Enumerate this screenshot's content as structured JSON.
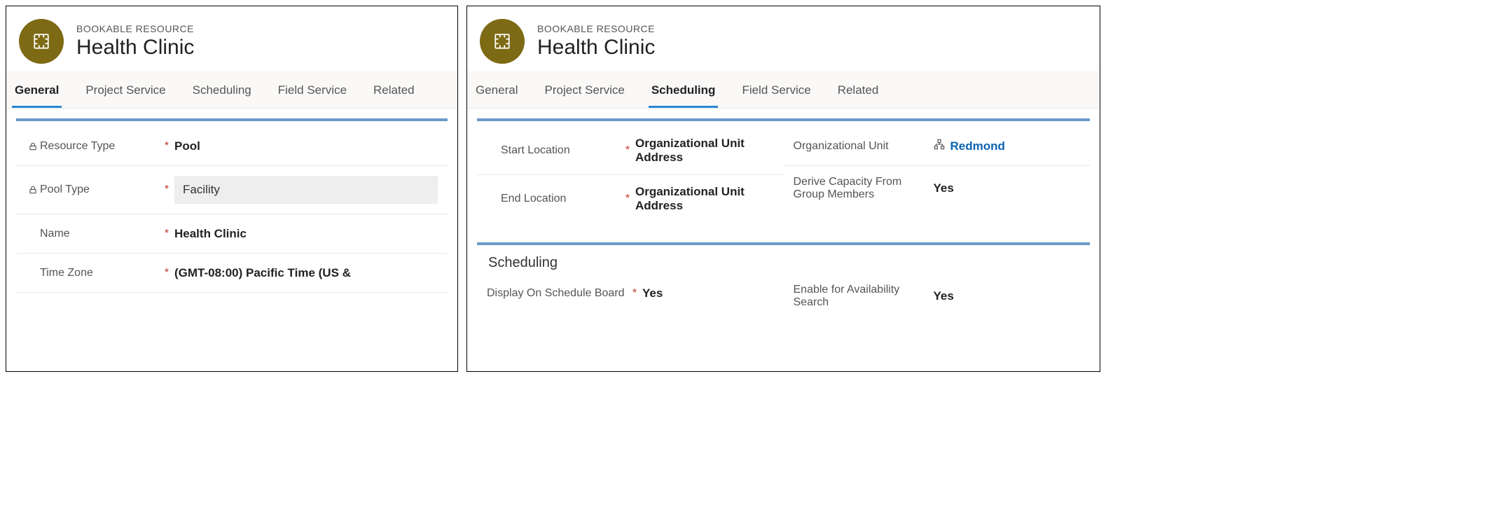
{
  "left": {
    "header": {
      "overline": "BOOKABLE RESOURCE",
      "title": "Health Clinic"
    },
    "tabs": [
      "General",
      "Project Service",
      "Scheduling",
      "Field Service",
      "Related"
    ],
    "active_tab": "General",
    "fields": {
      "resource_type": {
        "label": "Resource Type",
        "value": "Pool",
        "locked": true,
        "required": true
      },
      "pool_type": {
        "label": "Pool Type",
        "value": "Facility",
        "locked": true,
        "required": true
      },
      "name": {
        "label": "Name",
        "value": "Health Clinic",
        "locked": false,
        "required": true
      },
      "time_zone": {
        "label": "Time Zone",
        "value": "(GMT-08:00) Pacific Time (US &",
        "locked": false,
        "required": true
      }
    }
  },
  "right": {
    "header": {
      "overline": "BOOKABLE RESOURCE",
      "title": "Health Clinic"
    },
    "tabs": [
      "General",
      "Project Service",
      "Scheduling",
      "Field Service",
      "Related"
    ],
    "active_tab": "Scheduling",
    "section1": {
      "left": {
        "start_location": {
          "label": "Start Location",
          "value": "Organizational Unit Address",
          "required": true
        },
        "end_location": {
          "label": "End Location",
          "value": "Organizational Unit Address",
          "required": true
        }
      },
      "right": {
        "org_unit": {
          "label": "Organizational Unit",
          "value": "Redmond"
        },
        "derive_capacity": {
          "label": "Derive Capacity From Group Members",
          "value": "Yes"
        }
      }
    },
    "section2": {
      "title": "Scheduling",
      "left": {
        "display_on_board": {
          "label": "Display On Schedule Board",
          "value": "Yes",
          "required": true
        }
      },
      "right": {
        "enable_search": {
          "label": "Enable for Availability Search",
          "value": "Yes"
        }
      }
    }
  }
}
